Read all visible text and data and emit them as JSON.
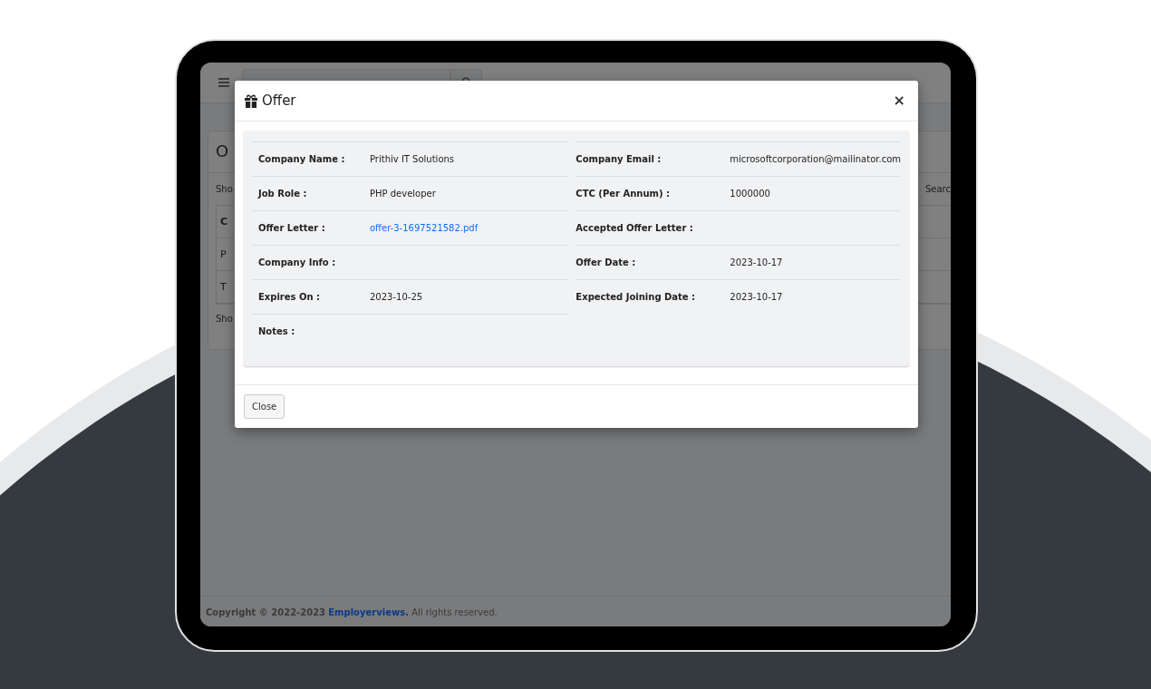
{
  "app": {
    "page_title": "O",
    "show_entries": "Sho",
    "search_label": "Searc",
    "table": {
      "header": "C",
      "rows": [
        "P",
        "T"
      ]
    },
    "show_info": "Sho"
  },
  "modal": {
    "title": "Offer",
    "close": "×",
    "left_fields": [
      {
        "label": "Company Name :",
        "value": "Prithiv IT Solutions",
        "kind": "text"
      },
      {
        "label": "Job Role :",
        "value": "PHP developer",
        "kind": "text"
      },
      {
        "label": "Offer Letter :",
        "value": "offer-3-1697521582.pdf",
        "kind": "link"
      },
      {
        "label": "Company Info :"
      },
      {
        "label": "Expires On :",
        "value": "2023-10-25",
        "kind": "text"
      },
      {
        "label": "Notes :"
      }
    ],
    "right_fields": [
      {
        "label": "Company Email :",
        "value": "microsoftcorporation@mailinator.com",
        "kind": "text"
      },
      {
        "label": "CTC (Per Annum) :",
        "value": "1000000",
        "kind": "text"
      },
      {
        "label": "Accepted Offer Letter :"
      },
      {
        "label": "Offer Date :",
        "value": "2023-10-17",
        "kind": "text"
      },
      {
        "label": "Expected Joining Date :",
        "value": "2023-10-17",
        "kind": "text"
      }
    ],
    "footer_button": "Close"
  },
  "footer": {
    "prefix": "**Copyright © 2022-2023** ",
    "link": "Employerviews.",
    "suffix": " All rights reserved."
  }
}
